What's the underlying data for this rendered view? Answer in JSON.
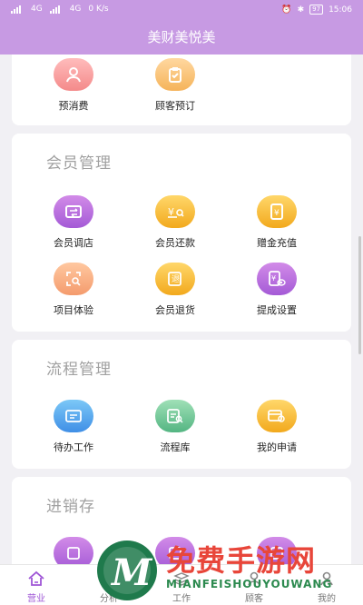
{
  "status": {
    "left": [
      "4G",
      "4G",
      "0 K/s"
    ],
    "battery": "97",
    "time": "15:06"
  },
  "title": "美财美悦美",
  "top_card": {
    "items": [
      {
        "label": "预消费",
        "icon": "user-icon",
        "color": "pink"
      },
      {
        "label": "顾客预订",
        "icon": "clipboard-icon",
        "color": "amber"
      }
    ]
  },
  "member_card": {
    "title": "会员管理",
    "items": [
      {
        "label": "会员调店",
        "icon": "transfer-card-icon",
        "color": "purple"
      },
      {
        "label": "会员还款",
        "icon": "yen-search-icon",
        "color": "yellow"
      },
      {
        "label": "赠金充值",
        "icon": "yen-document-icon",
        "color": "yellow"
      },
      {
        "label": "项目体验",
        "icon": "expand-search-icon",
        "color": "orange"
      },
      {
        "label": "会员退货",
        "icon": "refund-icon",
        "color": "yellow"
      },
      {
        "label": "提成设置",
        "icon": "yen-eye-icon",
        "color": "purple"
      }
    ]
  },
  "process_card": {
    "title": "流程管理",
    "items": [
      {
        "label": "待办工作",
        "icon": "card-icon",
        "color": "blue"
      },
      {
        "label": "流程库",
        "icon": "list-search-icon",
        "color": "green"
      },
      {
        "label": "我的申请",
        "icon": "application-icon",
        "color": "yellow"
      }
    ]
  },
  "inventory_card": {
    "title": "进销存",
    "items": [
      {
        "label": "",
        "icon": "box-icon",
        "color": "purple"
      },
      {
        "label": "",
        "icon": "document-icon",
        "color": "purple"
      },
      {
        "label": "",
        "icon": "cart-icon",
        "color": "purple"
      }
    ]
  },
  "tabbar": {
    "items": [
      {
        "label": "营业",
        "icon": "home-icon",
        "active": true
      },
      {
        "label": "分析",
        "icon": "chart-icon",
        "active": false
      },
      {
        "label": "工作",
        "icon": "stack-icon",
        "active": false
      },
      {
        "label": "顾客",
        "icon": "customer-icon",
        "active": false
      },
      {
        "label": "我的",
        "icon": "profile-icon",
        "active": false
      }
    ]
  },
  "watermark": {
    "text": "免费手游网",
    "sub": "MIANFEISHOUYOUWANG",
    "logo_letter": "M"
  },
  "colors": {
    "accent": "#c79ae3",
    "active_tab": "#9f56d6"
  }
}
